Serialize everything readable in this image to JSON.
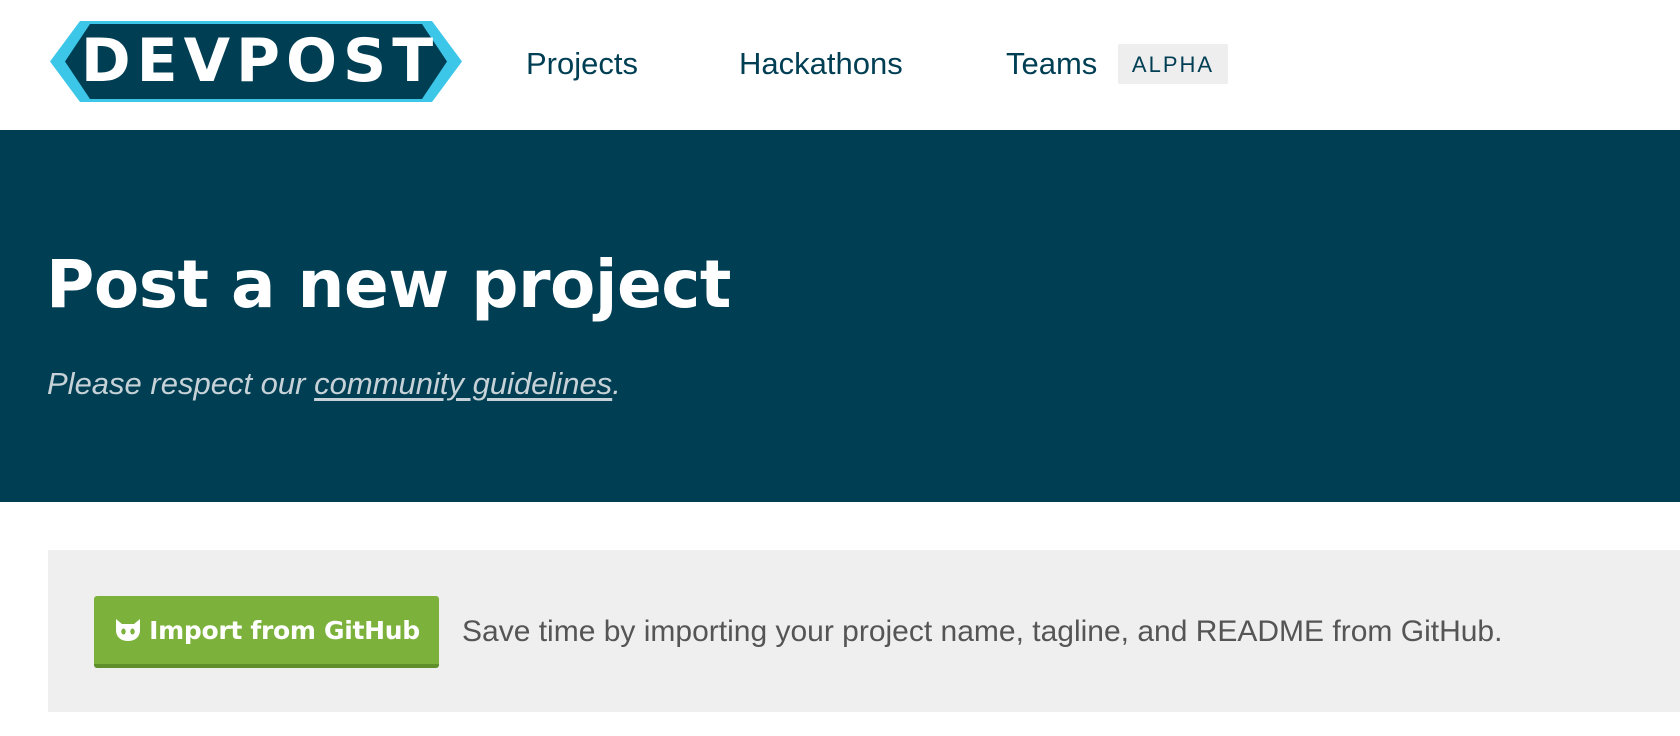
{
  "header": {
    "logo_text": "DEVPOST",
    "nav": [
      {
        "label": "Projects"
      },
      {
        "label": "Hackathons"
      },
      {
        "label": "Teams"
      }
    ],
    "teams_badge": "ALPHA"
  },
  "hero": {
    "title": "Post a new project",
    "subtitle_prefix": "Please respect our ",
    "guidelines_link": "community guidelines",
    "subtitle_suffix": "."
  },
  "import": {
    "button_label": "Import from GitHub",
    "button_icon": "github-octocat-icon",
    "description": "Save time by importing your project name, tagline, and README from GitHub."
  },
  "colors": {
    "brand_navy": "#003e54",
    "brand_cyan": "#3cc6e8",
    "github_green": "#7cb23c",
    "panel_gray": "#efefef"
  }
}
